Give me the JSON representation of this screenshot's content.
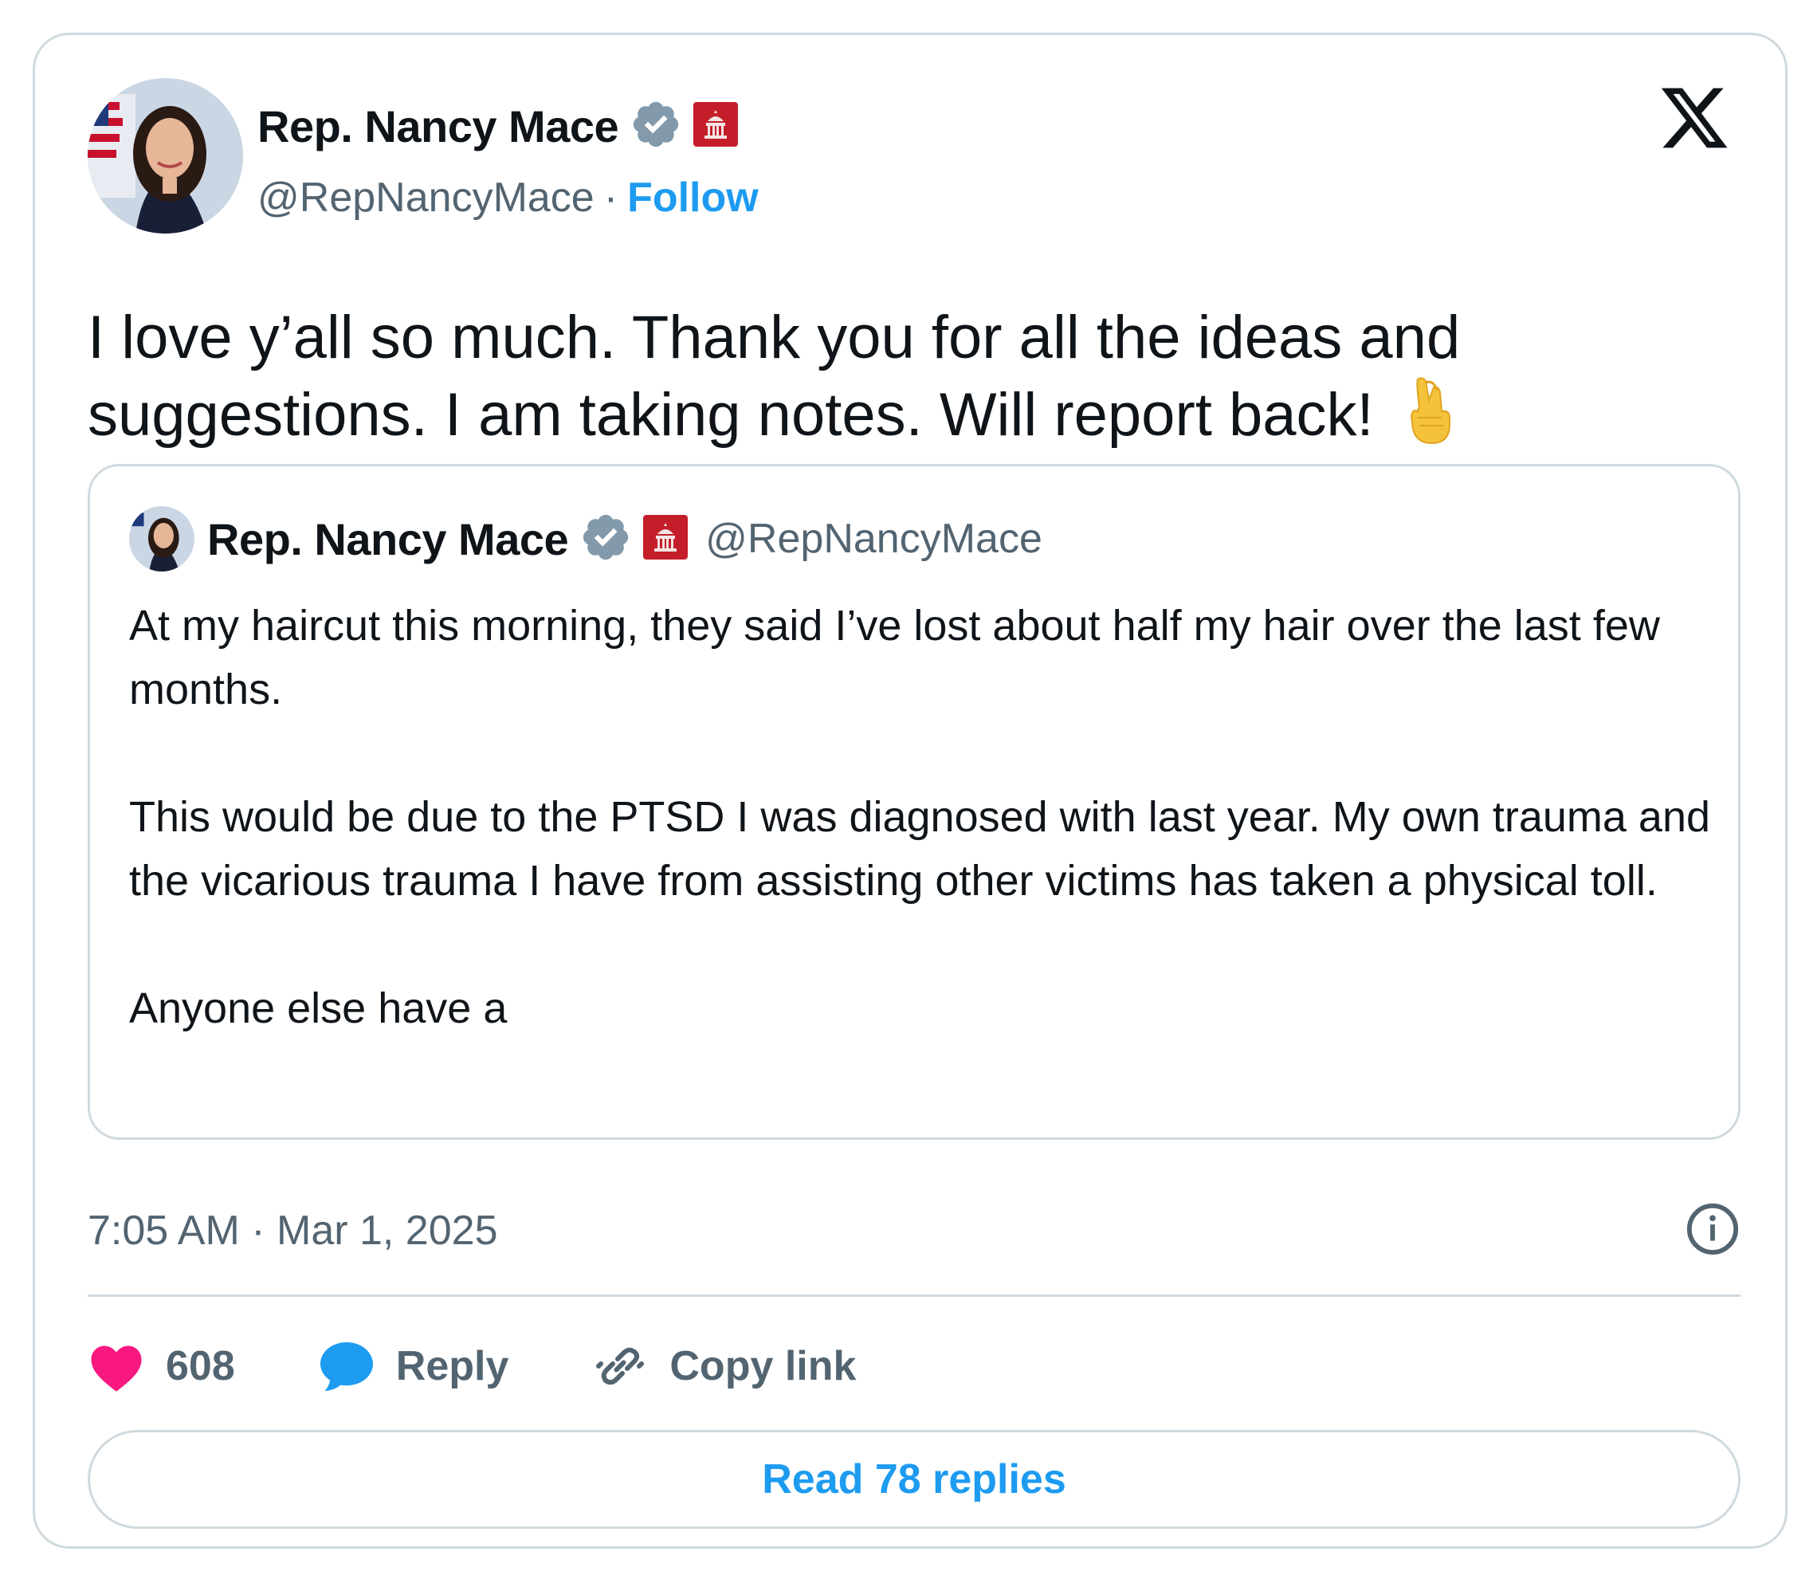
{
  "tweet": {
    "author": {
      "display_name": "Rep. Nancy Mace",
      "handle": "@RepNancyMace",
      "separator": "·",
      "follow_label": "Follow"
    },
    "text": "I love y’all so much. Thank you for all the ideas and suggestions. I am taking notes. Will report back!",
    "emoji": "crossed-fingers",
    "quoted": {
      "display_name": "Rep. Nancy Mace",
      "handle": "@RepNancyMace",
      "text": "At my haircut this morning, they said I’ve lost about half my hair over the last few months.\n\nThis would be due to the PTSD I was diagnosed with last year. My own trauma and the vicarious trauma I have from assisting other victims has taken a physical toll.\n\nAnyone else have a"
    },
    "timestamp": "7:05 AM · Mar 1, 2025",
    "actions": {
      "likes_count": "608",
      "reply_label": "Reply",
      "copy_link_label": "Copy link"
    },
    "read_replies_label": "Read 78 replies"
  },
  "colors": {
    "accent": "#1d9bf0",
    "text": "#0f1419",
    "secondary": "#536471",
    "border": "#cfd9de",
    "like": "#f91880",
    "verified": "#829aab",
    "gov_badge": "#c41e2a"
  }
}
